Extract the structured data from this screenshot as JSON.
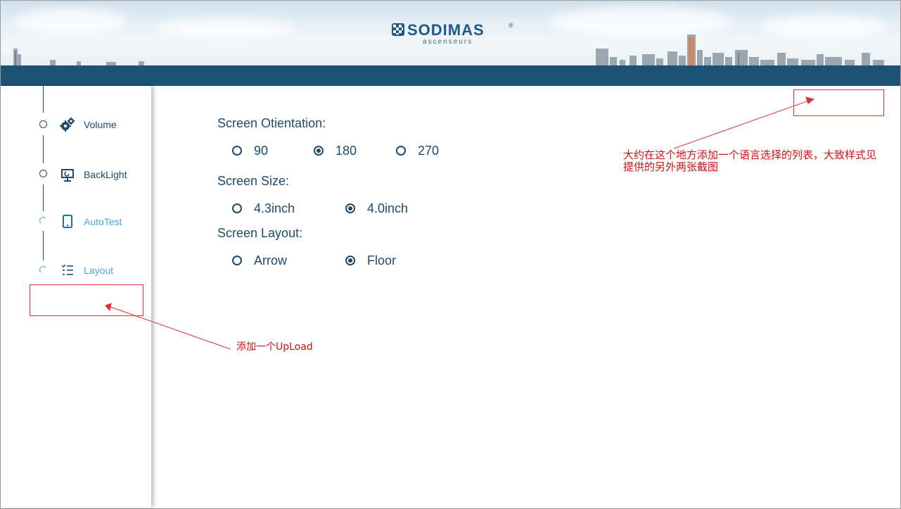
{
  "header": {
    "brand": "SODIMAS",
    "brand_mark": "®",
    "tagline": "ascenseurs"
  },
  "sidebar": {
    "items": [
      {
        "label": "Volume",
        "icon": "gears-icon",
        "state": "done"
      },
      {
        "label": "BackLight",
        "icon": "monitor-icon",
        "state": "done"
      },
      {
        "label": "AutoTest",
        "icon": "tablet-icon",
        "state": "active"
      },
      {
        "label": "Layout",
        "icon": "checklist-icon",
        "state": "active"
      }
    ]
  },
  "main": {
    "orientation": {
      "label": "Screen Otientation:",
      "options": [
        "90",
        "180",
        "270"
      ],
      "selected": "180"
    },
    "size": {
      "label": "Screen Size:",
      "options": [
        "4.3inch",
        "4.0inch"
      ],
      "selected": "4.0inch"
    },
    "layout": {
      "label": "Screen Layout:",
      "options": [
        "Arrow",
        "Floor"
      ],
      "selected": "Floor"
    }
  },
  "annotations": {
    "top_note_line1": "大约在这个地方添加一个语言选择的列表，大致样式见",
    "top_note_line2": "提供的另外两张截图",
    "side_note": "添加一个UpLoad"
  },
  "colors": {
    "primary": "#1d4a6e",
    "band": "#1c5276",
    "accent": "#4aa8dc",
    "annotation": "#e03030"
  }
}
